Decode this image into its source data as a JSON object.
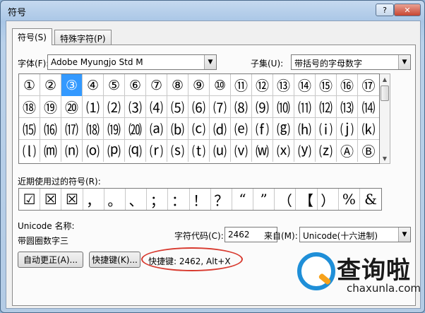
{
  "window": {
    "title": "符号",
    "help": "?",
    "close": "✕"
  },
  "tabs": [
    {
      "label": "符号(S)"
    },
    {
      "label": "特殊字符(P)"
    }
  ],
  "font": {
    "label": "字体(F):",
    "value": "Adobe Myungjo Std M"
  },
  "subset": {
    "label": "子集(U):",
    "value": "带括号的字母数字"
  },
  "symbol_rows": [
    [
      "①",
      "②",
      "③",
      "④",
      "⑤",
      "⑥",
      "⑦",
      "⑧",
      "⑨",
      "⑩",
      "⑪",
      "⑫",
      "⑬",
      "⑭",
      "⑮",
      "⑯",
      "⑰"
    ],
    [
      "⑱",
      "⑲",
      "⑳",
      "⑴",
      "⑵",
      "⑶",
      "⑷",
      "⑸",
      "⑹",
      "⑺",
      "⑻",
      "⑼",
      "⑽",
      "⑾",
      "⑿",
      "⒀",
      "⒁"
    ],
    [
      "⒂",
      "⒃",
      "⒄",
      "⒅",
      "⒆",
      "⒇",
      "⒜",
      "⒝",
      "⒞",
      "⒟",
      "⒠",
      "⒡",
      "⒢",
      "⒣",
      "⒤",
      "⒥",
      "⒦"
    ],
    [
      "⒧",
      "⒨",
      "⒩",
      "⒪",
      "⒫",
      "⒬",
      "⒭",
      "⒮",
      "⒯",
      "⒰",
      "⒱",
      "⒲",
      "⒳",
      "⒴",
      "⒵",
      "Ⓐ",
      "Ⓑ"
    ]
  ],
  "recent": {
    "label": "近期使用过的符号(R):",
    "symbols": [
      "☑",
      "☒",
      "☒",
      "，",
      "。",
      "、",
      "；",
      "：",
      "！",
      "？",
      "“",
      "”",
      "（",
      "【",
      "）",
      "%",
      "&"
    ]
  },
  "unicode_name": {
    "label": "Unicode 名称:",
    "value": "带圆圈数字三"
  },
  "char_code": {
    "label": "字符代码(C):",
    "value": "2462"
  },
  "from": {
    "label": "来自(M):",
    "value": "Unicode(十六进制)"
  },
  "buttons": {
    "autocorrect": "自动更正(A)...",
    "shortcut": "快捷键(K)..."
  },
  "shortcut_text": "快捷键: 2462, Alt+X",
  "watermark": {
    "big": "查询啦",
    "small": "chaxunla.com"
  },
  "colors": {
    "selection": "#3399ff",
    "highlight": "#d83a2f"
  }
}
